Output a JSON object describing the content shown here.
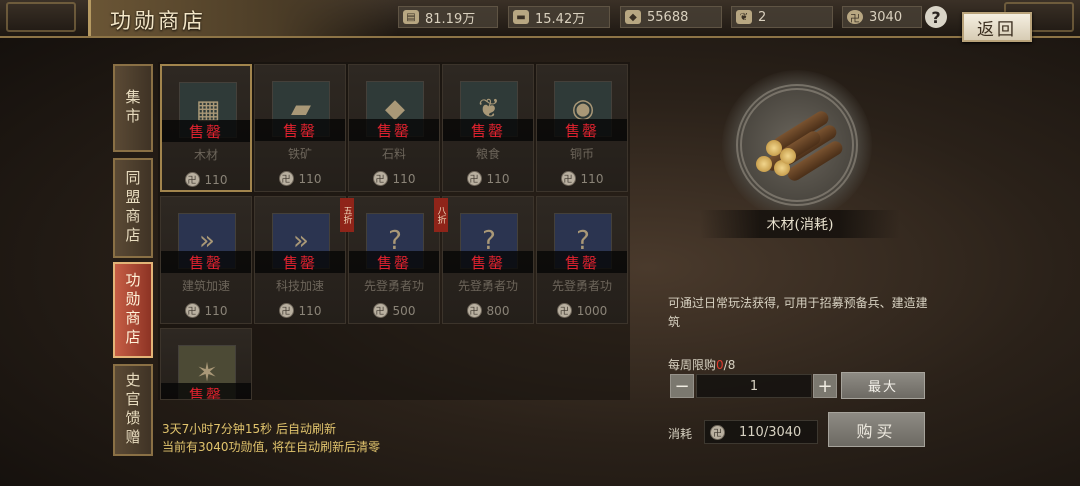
{
  "header": {
    "title": "功勋商店",
    "resources": [
      {
        "icon": "wood-icon",
        "value": "81.19万"
      },
      {
        "icon": "iron-icon",
        "value": "15.42万"
      },
      {
        "icon": "stone-icon",
        "value": "55688"
      },
      {
        "icon": "grain-icon",
        "value": "2"
      },
      {
        "icon": "merit-coin-icon",
        "value": "3040"
      }
    ],
    "help_label": "?",
    "back_label": "返回"
  },
  "tabs": [
    {
      "label": "集市",
      "active": false
    },
    {
      "label": "同盟商店",
      "active": false
    },
    {
      "label": "功勋商店",
      "active": true
    },
    {
      "label": "史官馈赠",
      "active": false
    }
  ],
  "items": [
    {
      "name": "木材",
      "price": "110",
      "status": "售罄",
      "icon": "wood-icon",
      "selected": true,
      "discount": ""
    },
    {
      "name": "铁矿",
      "price": "110",
      "status": "售罄",
      "icon": "iron-ore-icon",
      "selected": false,
      "discount": ""
    },
    {
      "name": "石料",
      "price": "110",
      "status": "售罄",
      "icon": "stone-icon",
      "selected": false,
      "discount": ""
    },
    {
      "name": "粮食",
      "price": "110",
      "status": "售罄",
      "icon": "grain-icon",
      "selected": false,
      "discount": ""
    },
    {
      "name": "铜币",
      "price": "110",
      "status": "售罄",
      "icon": "copper-coin-icon",
      "selected": false,
      "discount": ""
    },
    {
      "name": "建筑加速",
      "price": "110",
      "status": "售罄",
      "icon": "speedup-icon",
      "selected": false,
      "discount": ""
    },
    {
      "name": "科技加速",
      "price": "110",
      "status": "售罄",
      "icon": "speedup-icon",
      "selected": false,
      "discount": ""
    },
    {
      "name": "先登勇者功",
      "price": "500",
      "status": "售罄",
      "icon": "mystery-pack-icon",
      "selected": false,
      "discount": "五折"
    },
    {
      "name": "先登勇者功",
      "price": "800",
      "status": "售罄",
      "icon": "mystery-pack-icon",
      "selected": false,
      "discount": "八折"
    },
    {
      "name": "先登勇者功",
      "price": "1000",
      "status": "售罄",
      "icon": "mystery-pack-icon",
      "selected": false,
      "discount": ""
    },
    {
      "name": "",
      "price": "",
      "status": "售罄",
      "icon": "token-icon",
      "selected": false,
      "discount": ""
    }
  ],
  "refresh": {
    "line1": "3天7小时7分钟15秒 后自动刷新",
    "line2": "当前有3040功勋值, 将在自动刷新后清零"
  },
  "detail": {
    "title": "木材(消耗)",
    "description": "可通过日常玩法获得, 可用于招募预备兵、建造建筑",
    "limit_label": "每周限购",
    "limit_current": "0",
    "limit_max": "/8",
    "quantity": "1",
    "minus_label": "−",
    "plus_label": "+",
    "max_label": "最大",
    "cost_label": "消耗",
    "cost_value": "110/3040",
    "buy_label": "购买"
  }
}
